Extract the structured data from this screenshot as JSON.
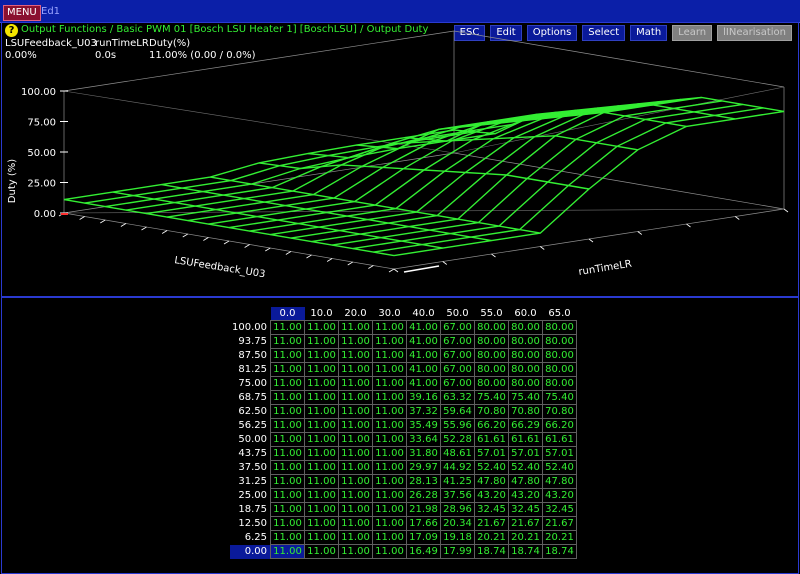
{
  "menubar": {
    "menu_label": "MENU",
    "tab_label": "Ed1"
  },
  "breadcrumb": "Output Functions / Basic PWM 01 [Bosch LSU Heater 1] [BoschLSU] / Output Duty",
  "toolbar": [
    {
      "label": "ESC",
      "enabled": true
    },
    {
      "label": "Edit",
      "enabled": true
    },
    {
      "label": "Options",
      "enabled": true
    },
    {
      "label": "Select",
      "enabled": true
    },
    {
      "label": "Math",
      "enabled": true
    },
    {
      "label": "Learn",
      "enabled": false
    },
    {
      "label": "lINearisation",
      "enabled": false
    }
  ],
  "readouts": {
    "axis1_name": "LSUFeedback_U03",
    "axis1_value": "0.00%",
    "axis2_name": "runTimeLR",
    "axis2_value": "0.0s",
    "output_name": "Duty(%)",
    "output_value": "11.00% (0.00 / 0.0%)"
  },
  "chart3d": {
    "zlabel": "Duty (%)",
    "xlabel": "LSUFeedback_U03",
    "ylabel": "runTimeLR",
    "zticks": [
      "100.00",
      "75.00",
      "50.00",
      "25.00",
      "0.00"
    ],
    "line_color": "#33ee33"
  },
  "table": {
    "col_headers": [
      "0.0",
      "10.0",
      "20.0",
      "30.0",
      "40.0",
      "50.0",
      "55.0",
      "60.0",
      "65.0"
    ],
    "row_headers": [
      "100.00",
      "93.75",
      "87.50",
      "81.25",
      "75.00",
      "68.75",
      "62.50",
      "56.25",
      "50.00",
      "43.75",
      "37.50",
      "31.25",
      "25.00",
      "18.75",
      "12.50",
      "6.25",
      "0.00"
    ],
    "rows": [
      [
        "11.00",
        "11.00",
        "11.00",
        "11.00",
        "41.00",
        "67.00",
        "80.00",
        "80.00",
        "80.00"
      ],
      [
        "11.00",
        "11.00",
        "11.00",
        "11.00",
        "41.00",
        "67.00",
        "80.00",
        "80.00",
        "80.00"
      ],
      [
        "11.00",
        "11.00",
        "11.00",
        "11.00",
        "41.00",
        "67.00",
        "80.00",
        "80.00",
        "80.00"
      ],
      [
        "11.00",
        "11.00",
        "11.00",
        "11.00",
        "41.00",
        "67.00",
        "80.00",
        "80.00",
        "80.00"
      ],
      [
        "11.00",
        "11.00",
        "11.00",
        "11.00",
        "41.00",
        "67.00",
        "80.00",
        "80.00",
        "80.00"
      ],
      [
        "11.00",
        "11.00",
        "11.00",
        "11.00",
        "39.16",
        "63.32",
        "75.40",
        "75.40",
        "75.40"
      ],
      [
        "11.00",
        "11.00",
        "11.00",
        "11.00",
        "37.32",
        "59.64",
        "70.80",
        "70.80",
        "70.80"
      ],
      [
        "11.00",
        "11.00",
        "11.00",
        "11.00",
        "35.49",
        "55.96",
        "66.20",
        "66.29",
        "66.20"
      ],
      [
        "11.00",
        "11.00",
        "11.00",
        "11.00",
        "33.64",
        "52.28",
        "61.61",
        "61.61",
        "61.61"
      ],
      [
        "11.00",
        "11.00",
        "11.00",
        "11.00",
        "31.80",
        "48.61",
        "57.01",
        "57.01",
        "57.01"
      ],
      [
        "11.00",
        "11.00",
        "11.00",
        "11.00",
        "29.97",
        "44.92",
        "52.40",
        "52.40",
        "52.40"
      ],
      [
        "11.00",
        "11.00",
        "11.00",
        "11.00",
        "28.13",
        "41.25",
        "47.80",
        "47.80",
        "47.80"
      ],
      [
        "11.00",
        "11.00",
        "11.00",
        "11.00",
        "26.28",
        "37.56",
        "43.20",
        "43.20",
        "43.20"
      ],
      [
        "11.00",
        "11.00",
        "11.00",
        "11.00",
        "21.98",
        "28.96",
        "32.45",
        "32.45",
        "32.45"
      ],
      [
        "11.00",
        "11.00",
        "11.00",
        "11.00",
        "17.66",
        "20.34",
        "21.67",
        "21.67",
        "21.67"
      ],
      [
        "11.00",
        "11.00",
        "11.00",
        "11.00",
        "17.09",
        "19.18",
        "20.21",
        "20.21",
        "20.21"
      ],
      [
        "11.00",
        "11.00",
        "11.00",
        "11.00",
        "16.49",
        "17.99",
        "18.74",
        "18.74",
        "18.74"
      ]
    ],
    "selected": {
      "row": 16,
      "col": 0
    }
  }
}
